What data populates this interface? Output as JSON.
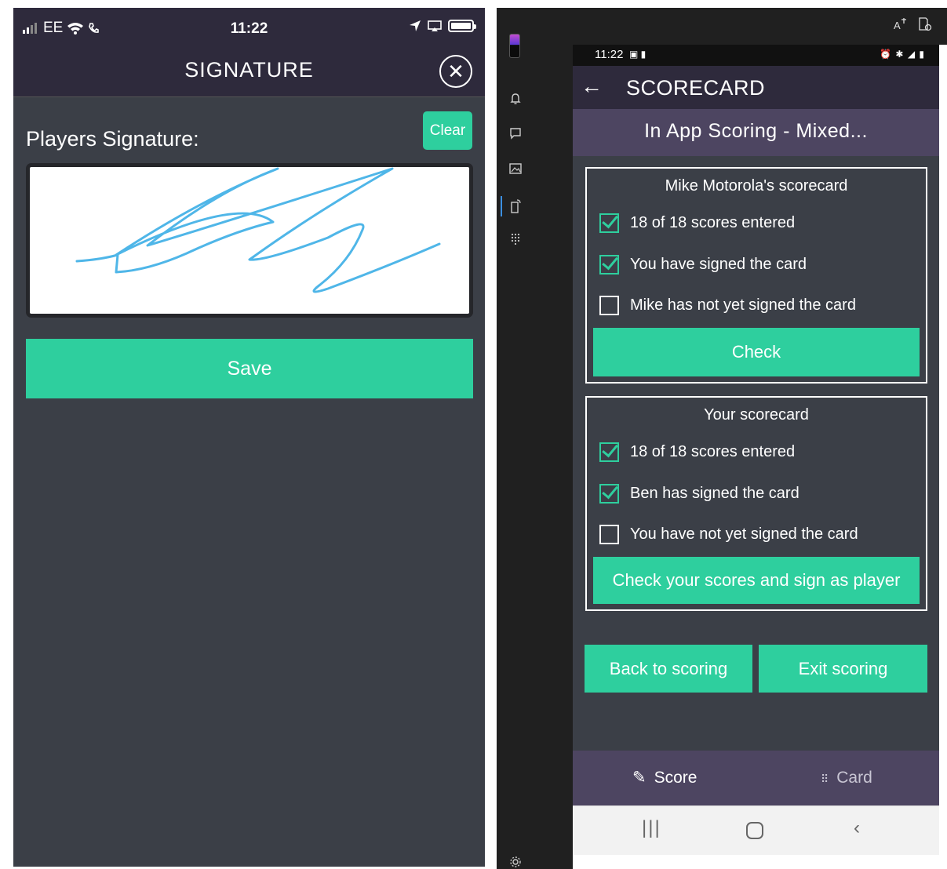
{
  "left_phone": {
    "status": {
      "carrier": "EE",
      "time": "11:22"
    },
    "header": {
      "title": "SIGNATURE",
      "close_icon": "close-circle-icon"
    },
    "signature_label": "Players Signature:",
    "clear_label": "Clear",
    "save_label": "Save"
  },
  "right_phone": {
    "status": {
      "time": "11:22"
    },
    "header": {
      "back_icon": "arrow-left-icon",
      "title": "SCORECARD"
    },
    "subtitle": "In App Scoring - Mixed...",
    "card1": {
      "title": "Mike Motorola's scorecard",
      "items": [
        {
          "checked": true,
          "text": "18 of 18 scores entered"
        },
        {
          "checked": true,
          "text": "You have signed the card"
        },
        {
          "checked": false,
          "text": "Mike has not yet signed the card"
        }
      ],
      "button": "Check"
    },
    "card2": {
      "title": "Your scorecard",
      "items": [
        {
          "checked": true,
          "text": "18 of 18 scores entered"
        },
        {
          "checked": true,
          "text": "Ben has signed the card"
        },
        {
          "checked": false,
          "text": "You have not yet signed the card"
        }
      ],
      "button": "Check your scores and sign as player"
    },
    "back_to_scoring": "Back to scoring",
    "exit_scoring": "Exit scoring",
    "tabs": [
      {
        "label": "Score",
        "icon": "pencil-icon"
      },
      {
        "label": "Card",
        "icon": "grid-icon"
      }
    ]
  },
  "colors": {
    "accent": "#2ecf9e",
    "header": "#2e2a3c",
    "subheader": "#4d4561",
    "background": "#3b3f47",
    "signature_ink": "#4fb6e8"
  }
}
